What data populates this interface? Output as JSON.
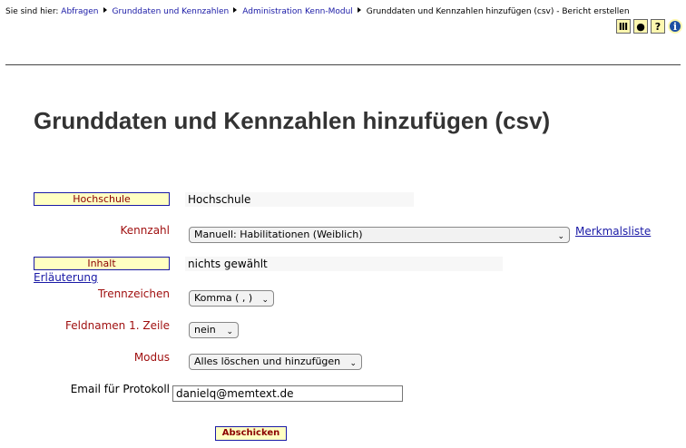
{
  "breadcrumb": {
    "prefix": "Sie sind hier:",
    "items": [
      "Abfragen",
      "Grunddaten und Kennzahlen",
      "Administration Kenn-Modul"
    ],
    "current": "Grunddaten und Kennzahlen hinzufügen (csv) - Bericht erstellen"
  },
  "toolbar": {
    "icons": [
      "university-icon",
      "record-icon",
      "help-icon",
      "info-icon"
    ]
  },
  "page_title": "Grunddaten und Kennzahlen hinzufügen (csv)",
  "form": {
    "hochschule": {
      "label": "Hochschule",
      "value": "Hochschule"
    },
    "kennzahl": {
      "label": "Kennzahl",
      "selected": "Manuell: Habilitationen (Weiblich)",
      "link": "Merkmalsliste"
    },
    "inhalt": {
      "label": "Inhalt",
      "value": "nichts gewählt",
      "link": "Erläuterung"
    },
    "trennzeichen": {
      "label": "Trennzeichen",
      "selected": "Komma ( , )"
    },
    "feldnamen": {
      "label": "Feldnamen 1. Zeile",
      "selected": "nein"
    },
    "modus": {
      "label": "Modus",
      "selected": "Alles löschen und hinzufügen"
    },
    "email": {
      "label": "Email für Protokoll",
      "value": "danielq@memtext.de"
    },
    "submit_label": "Abschicken"
  },
  "colors": {
    "link": "#1a1aa6",
    "label": "#a01010",
    "highlight": "#ffffc2"
  }
}
